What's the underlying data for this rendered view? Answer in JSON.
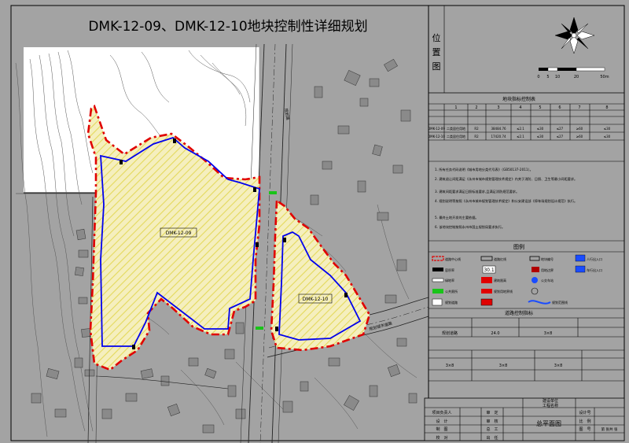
{
  "title": "DMK-12-09、DMK-12-10地块控制性详细规划",
  "map": {
    "parcel_labels": [
      "DMK-12-09",
      "DMK-12-10"
    ],
    "road_label_upper": "规划路",
    "road_label_lower": "规划城市道路"
  },
  "location_panel": {
    "label_chars": [
      "位",
      "置",
      "图"
    ],
    "scale_ticks": [
      "0",
      "5",
      "10",
      "20",
      "50m"
    ]
  },
  "index_table": {
    "title": "地块指标控制表",
    "col_numbers": [
      "1",
      "2",
      "3",
      "4",
      "5",
      "6",
      "7",
      "8"
    ],
    "rows": [
      [
        "DMK-12-09",
        "二类居住用地",
        "R2",
        "38484.76",
        "≤2.1",
        "≤30",
        "≤27",
        "≥60",
        "≤30"
      ],
      [
        "DMK-12-10",
        "二类居住用地",
        "R2",
        "17420.74",
        "≤2.1",
        "≤30",
        "≤27",
        "≥60",
        "≤30"
      ]
    ]
  },
  "notes": [
    "1. 所有任务代码说明《城市用地分类代号表》（GB50137-2011）。",
    "2. 建筑退让间距满足《永州市城市规划管理技术规定》内关于消防、日照、卫生等最小间距要求。",
    "3. 建筑间距要求满足日照标准要求,且满足消防规范要求。",
    "4. 规划说明等按照《永州市城市规划管理技术规定》和公安建设部《停车场规划设计规范》执行。",
    "5. 最终土地开发的主要依据。",
    "6. 该地块控制按照永州市国土规划局要求执行。"
  ],
  "legend": {
    "title": "图例",
    "items": [
      "道路中心线",
      "道路红线",
      "地块编号",
      "容积率",
      "用地边界",
      "绿地率",
      "建筑限高",
      "公交车站",
      "公共厕所",
      "人行出入口",
      "车行出入口",
      "规划用地界线",
      "规划道路",
      "规划范围线"
    ],
    "code_values": [
      "30.1"
    ]
  },
  "road_table": {
    "title": "道路控制指标",
    "rows": [
      [
        "规划道路",
        "24.0",
        "3×8"
      ]
    ]
  },
  "bottom_table": {
    "cells": [
      "3×8",
      "3×8",
      "3×8"
    ]
  },
  "title_block": {
    "labels": [
      "项目负责人",
      "设　计",
      "制　图",
      "校　对",
      "审　定",
      "审　核",
      "总　工",
      "出　任"
    ],
    "project_labels": [
      "建设单位",
      "工程名称"
    ],
    "drawing_name": "总平面图",
    "right_labels": [
      "设计号",
      "比　例",
      "图　号"
    ],
    "right_values": [
      "第 张共 张"
    ]
  },
  "colors": {
    "background": "#a3a3a3",
    "red_line": "#e00000",
    "blue_line": "#0000ee",
    "hatch": "#e8df6a",
    "parcel_fill": "#f5efbe",
    "green_node": "#19c419"
  }
}
